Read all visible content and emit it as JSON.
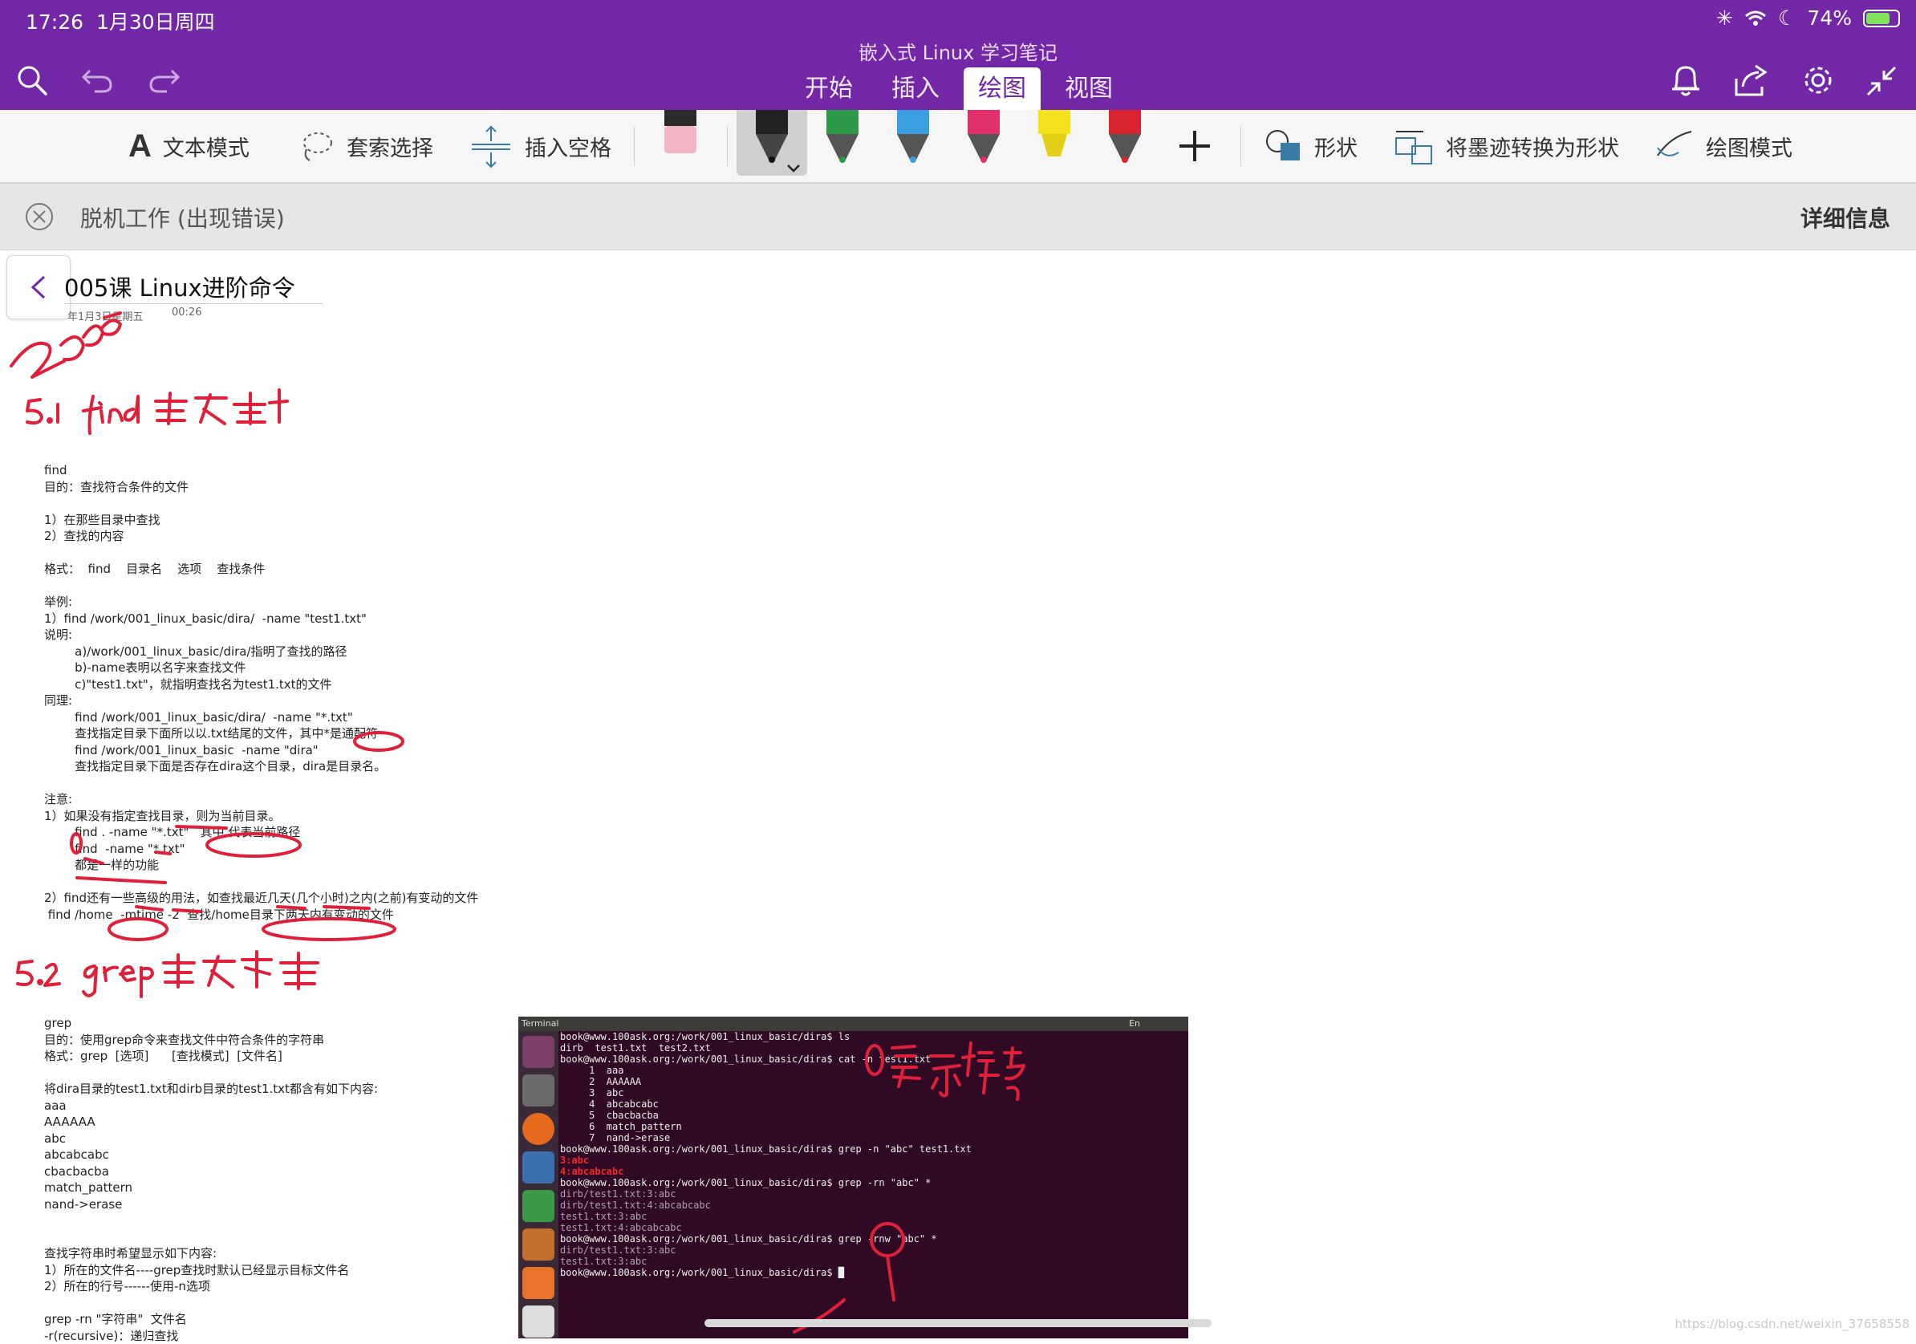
{
  "status": {
    "time": "17:26",
    "date": "1月30日周四",
    "battery": "74%",
    "battery_level": 0.74
  },
  "app": {
    "doc_title": "嵌入式 Linux 学习笔记",
    "tabs": [
      {
        "label": "开始",
        "active": false
      },
      {
        "label": "插入",
        "active": false
      },
      {
        "label": "绘图",
        "active": true
      },
      {
        "label": "视图",
        "active": false
      }
    ]
  },
  "ribbon": {
    "text_mode": "文本模式",
    "lasso_select": "套索选择",
    "insert_space": "插入空格",
    "shapes": "形状",
    "ink_to_shape": "将墨迹转换为形状",
    "draw_mode": "绘图模式",
    "pen_colors": [
      "#333333",
      "#2e9a48",
      "#3a9fe0",
      "#e2306c",
      "#f4e21e",
      "#d9242f"
    ]
  },
  "banner": {
    "message": "脱机工作 (出现错误)",
    "detail": "详细信息"
  },
  "page": {
    "title": "005课 Linux进阶命令",
    "date": "年1月3日星期五",
    "time": "00:26",
    "section1": [
      "find",
      "目的：查找符合条件的文件",
      "",
      "1）在那些目录中查找",
      "2）查找的内容",
      "",
      "格式：  find    目录名    选项    查找条件",
      "",
      "举例:",
      "1）find /work/001_linux_basic/dira/  -name \"test1.txt\"",
      "说明:",
      "        a)/work/001_linux_basic/dira/指明了查找的路径",
      "        b)-name表明以名字来查找文件",
      "        c)\"test1.txt\"，就指明查找名为test1.txt的文件",
      "同理:",
      "        find /work/001_linux_basic/dira/  -name \"*.txt\"",
      "        查找指定目录下面所以以.txt结尾的文件，其中*是通配符",
      "        find /work/001_linux_basic  -name \"dira\"",
      "        查找指定目录下面是否存在dira这个目录，dira是目录名。",
      "",
      "注意:",
      "1）如果没有指定查找目录，则为当前目录。",
      "        find . -name \"*.txt\"   其中.代表当前路径",
      "        find  -name \"*.txt\"",
      "        都是一样的功能",
      "",
      "2）find还有一些高级的用法，如查找最近几天(几个小时)之内(之前)有变动的文件",
      " find /home  -mtime -2  查找/home目录下两天内有变动的文件"
    ],
    "section2": [
      "grep",
      "目的：使用grep命令来查找文件中符合条件的字符串",
      "格式：grep  [选项]      [查找模式]  [文件名]",
      "",
      "将dira目录的test1.txt和dirb目录的test1.txt都含有如下内容:",
      "aaa",
      "AAAAAA",
      "abc",
      "abcabcabc",
      "cbacbacba",
      "match_pattern",
      "nand->erase",
      "",
      "",
      "查找字符串时希望显示如下内容:",
      "1）所在的文件名----grep查找时默认已经显示目标文件名",
      "2）所在的行号------使用-n选项",
      "",
      "grep -rn \"字符串\"  文件名",
      "-r(recursive)：递归查找"
    ]
  },
  "terminal": {
    "title": "Terminal",
    "indicator": "En",
    "lines": [
      {
        "t": "book@www.100ask.org:/work/001_linux_basic/dira$ ls",
        "c": ""
      },
      {
        "t": "dirb  test1.txt  test2.txt",
        "c": ""
      },
      {
        "t": "book@www.100ask.org:/work/001_linux_basic/dira$ cat -n test1.txt",
        "c": ""
      },
      {
        "t": "     1  aaa",
        "c": ""
      },
      {
        "t": "     2  AAAAAA",
        "c": ""
      },
      {
        "t": "     3  abc",
        "c": ""
      },
      {
        "t": "     4  abcabcabc",
        "c": ""
      },
      {
        "t": "     5  cbacbacba",
        "c": ""
      },
      {
        "t": "     6  match_pattern",
        "c": ""
      },
      {
        "t": "     7  nand->erase",
        "c": ""
      },
      {
        "t": "book@www.100ask.org:/work/001_linux_basic/dira$ grep -n \"abc\" test1.txt",
        "c": ""
      },
      {
        "t": "3:abc",
        "c": "red"
      },
      {
        "t": "4:abcabcabc",
        "c": "red"
      },
      {
        "t": "book@www.100ask.org:/work/001_linux_basic/dira$ grep -rn \"abc\" *",
        "c": ""
      },
      {
        "t": "dirb/test1.txt:3:abc",
        "c": "mag"
      },
      {
        "t": "dirb/test1.txt:4:abcabcabc",
        "c": "mag"
      },
      {
        "t": "test1.txt:3:abc",
        "c": "mag"
      },
      {
        "t": "test1.txt:4:abcabcabc",
        "c": "mag"
      },
      {
        "t": "book@www.100ask.org:/work/001_linux_basic/dira$ grep -rnw \"abc\" *",
        "c": ""
      },
      {
        "t": "dirb/test1.txt:3:abc",
        "c": "mag"
      },
      {
        "t": "test1.txt:3:abc",
        "c": "mag"
      },
      {
        "t": "book@www.100ask.org:/work/001_linux_basic/dira$ █",
        "c": ""
      }
    ]
  },
  "watermark": "https://blog.csdn.net/weixin_37658558",
  "colors": {
    "accent": "#7228a6",
    "ink": "#e0203a"
  }
}
